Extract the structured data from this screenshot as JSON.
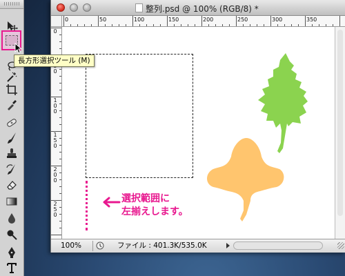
{
  "window": {
    "title": "整列.psd @ 100% (RGB/8) *"
  },
  "tooltip": {
    "text": "長方形選択ツール (M)"
  },
  "ruler": {
    "top_labels": [
      "0",
      "50",
      "100",
      "150",
      "200",
      "250",
      "300",
      "350"
    ],
    "left_labels": [
      "0",
      "5\n0",
      "1\n0\n0",
      "1\n5\n0",
      "2\n0\n0",
      "2\n5\n0"
    ]
  },
  "canvas": {
    "annotation_line1": "選択範囲に",
    "annotation_line2": "左揃えします。",
    "green_leaf_color": "#8bd34f",
    "orange_leaf_color": "#ffc56e",
    "accent_color": "#e8188f"
  },
  "status": {
    "zoom": "100%",
    "file_info": "ファイル : 401.3K/535.0K"
  },
  "tools": {
    "active_tool": "rectangular-marquee-tool",
    "items": [
      "move-tool",
      "rectangular-marquee-tool",
      "lasso-tool",
      "magic-wand-tool",
      "crop-tool",
      "eyedropper-tool",
      "healing-brush-tool",
      "brush-tool",
      "clone-stamp-tool",
      "history-brush-tool",
      "eraser-tool",
      "gradient-tool",
      "blur-tool",
      "dodge-tool",
      "pen-tool",
      "type-tool"
    ]
  }
}
